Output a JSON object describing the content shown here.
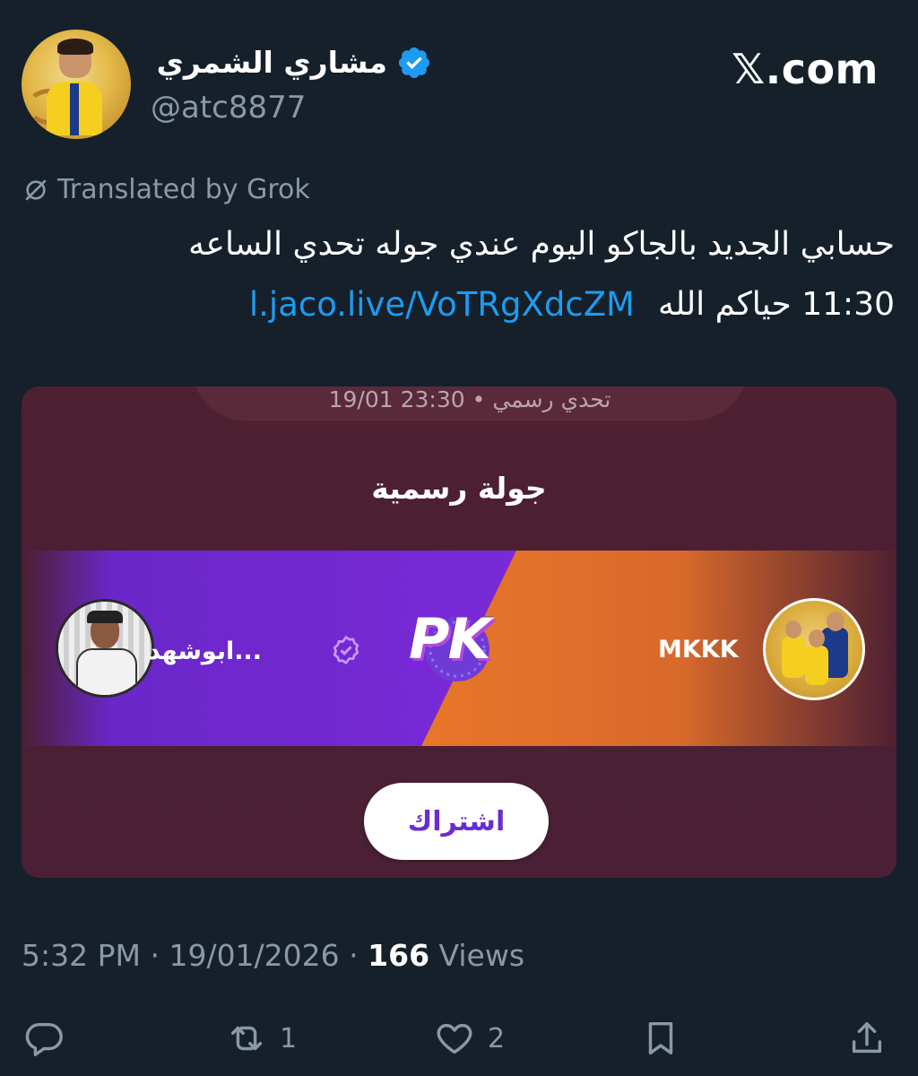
{
  "author": {
    "display_name": "مشاري الشمري",
    "handle": "@atc8877",
    "verified": true
  },
  "brand": "𝕏.com",
  "translation": {
    "label": "Translated by Grok"
  },
  "tweet": {
    "line1": "حسابي الجديد بالجاكو اليوم عندي جوله تحدي الساعه",
    "line2_text": "11:30 حياكم الله",
    "link": "l.jaco.live/VoTRgXdcZM"
  },
  "card": {
    "meta": "19/01 23:30 • تحدي رسمي",
    "title": "جولة رسمية",
    "pk_label": "PK",
    "player_left_name": "...ابوشهد",
    "player_right_name": "MKKK",
    "subscribe_label": "اشتراك"
  },
  "footer": {
    "time": "5:32 PM",
    "date": "19/01/2026",
    "views_count": "166",
    "views_label": "Views"
  },
  "actions": {
    "reply_count": "",
    "retweet_count": "1",
    "like_count": "2"
  },
  "colors": {
    "background": "#15202b",
    "link": "#1d9bf0",
    "muted": "#8b98a5",
    "verified": "#1d9bf0",
    "pk_purple": "#7a2ad8",
    "pk_orange": "#e8762a"
  }
}
